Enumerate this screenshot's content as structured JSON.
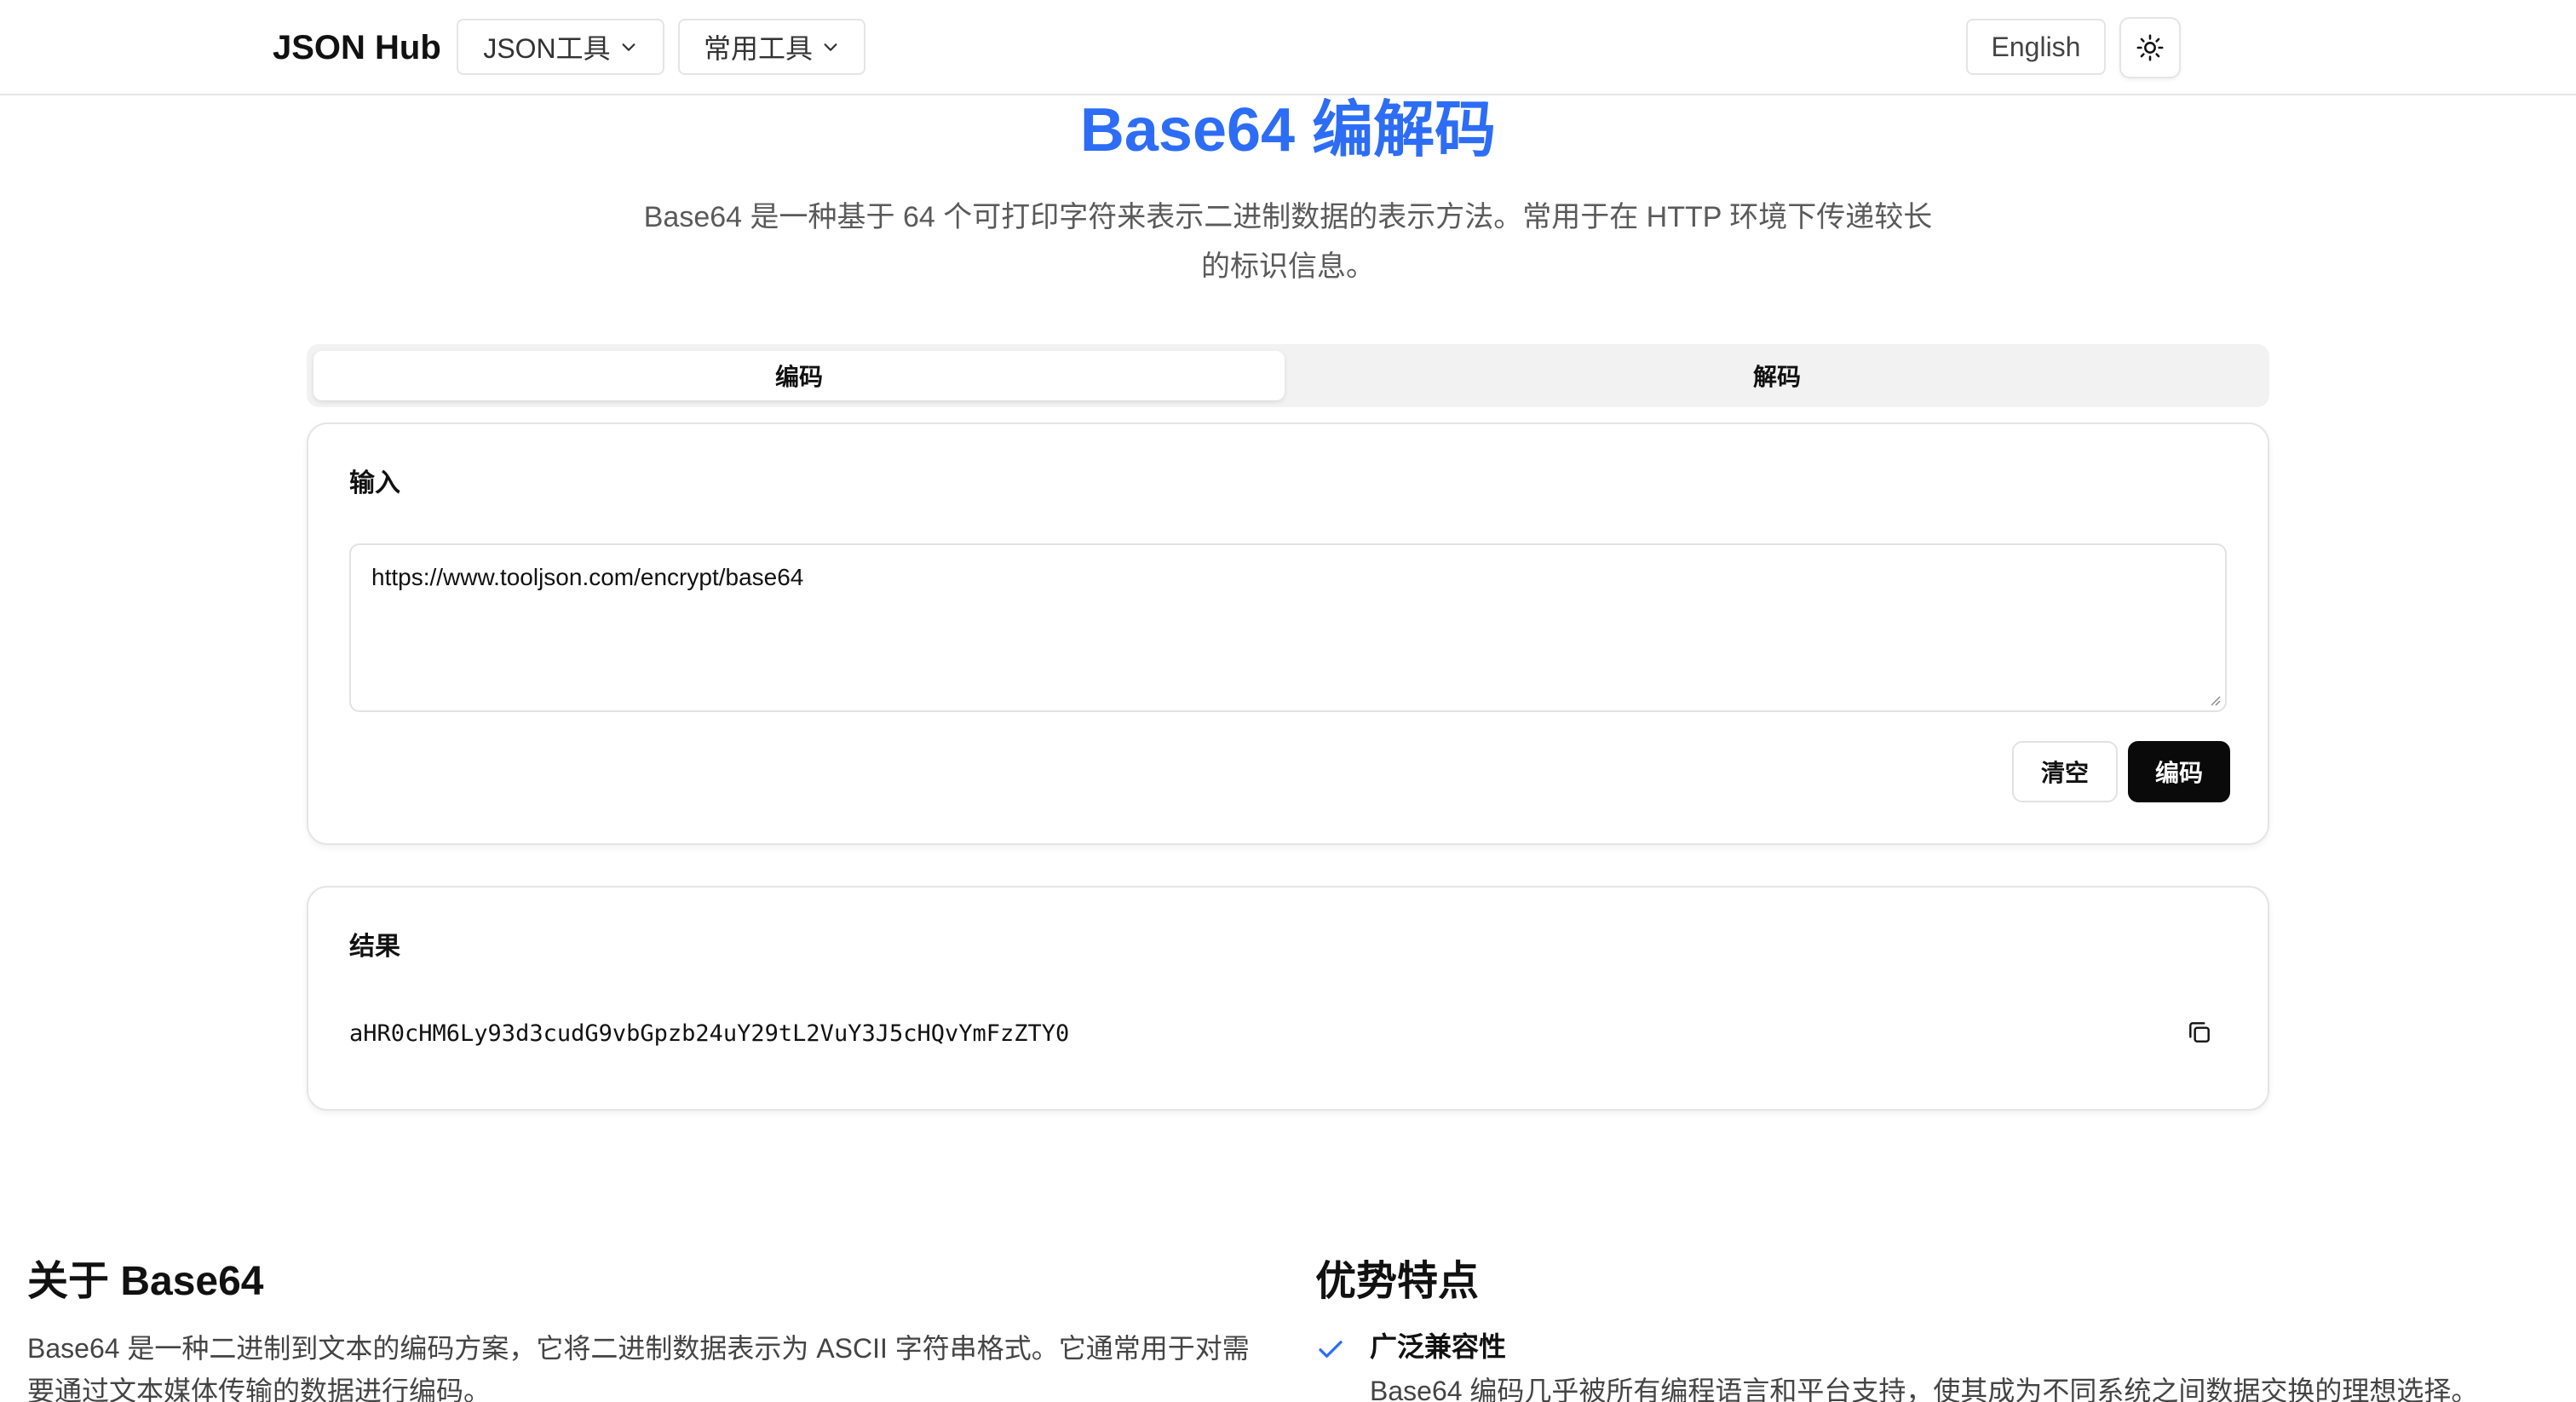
{
  "header": {
    "brand": "JSON Hub",
    "nav": [
      {
        "label": "JSON工具",
        "icon": "chevron-down-icon"
      },
      {
        "label": "常用工具",
        "icon": "chevron-down-icon"
      }
    ],
    "language_label": "English",
    "theme_icon": "sun-icon"
  },
  "hero": {
    "title": "Base64 编解码",
    "description": "Base64 是一种基于 64 个可打印字符来表示二进制数据的表示方法。常用于在 HTTP 环境下传递较长的标识信息。"
  },
  "tabs": [
    {
      "label": "编码",
      "active": true
    },
    {
      "label": "解码",
      "active": false
    }
  ],
  "input_card": {
    "label": "输入",
    "value": "https://www.tooljson.com/encrypt/base64",
    "clear_label": "清空",
    "encode_label": "编码"
  },
  "result_card": {
    "label": "结果",
    "value": "aHR0cHM6Ly93d3cudG9vbGpzb24uY29tL2VuY3J5cHQvYmFzZTY0",
    "copy_icon": "copy-icon"
  },
  "about": {
    "title": "关于 Base64",
    "text": "Base64 是一种二进制到文本的编码方案，它将二进制数据表示为 ASCII 字符串格式。它通常用于对需要通过文本媒体传输的数据进行编码。"
  },
  "advantages": {
    "title": "优势特点",
    "items": [
      {
        "title": "广泛兼容性",
        "text": "Base64 编码几乎被所有编程语言和平台支持，使其成为不同系统之间数据交换的理想选择。"
      }
    ]
  },
  "colors": {
    "accent": "#2d6df6",
    "primary_button": "#0a0a0a",
    "check": "#2d6df6"
  }
}
